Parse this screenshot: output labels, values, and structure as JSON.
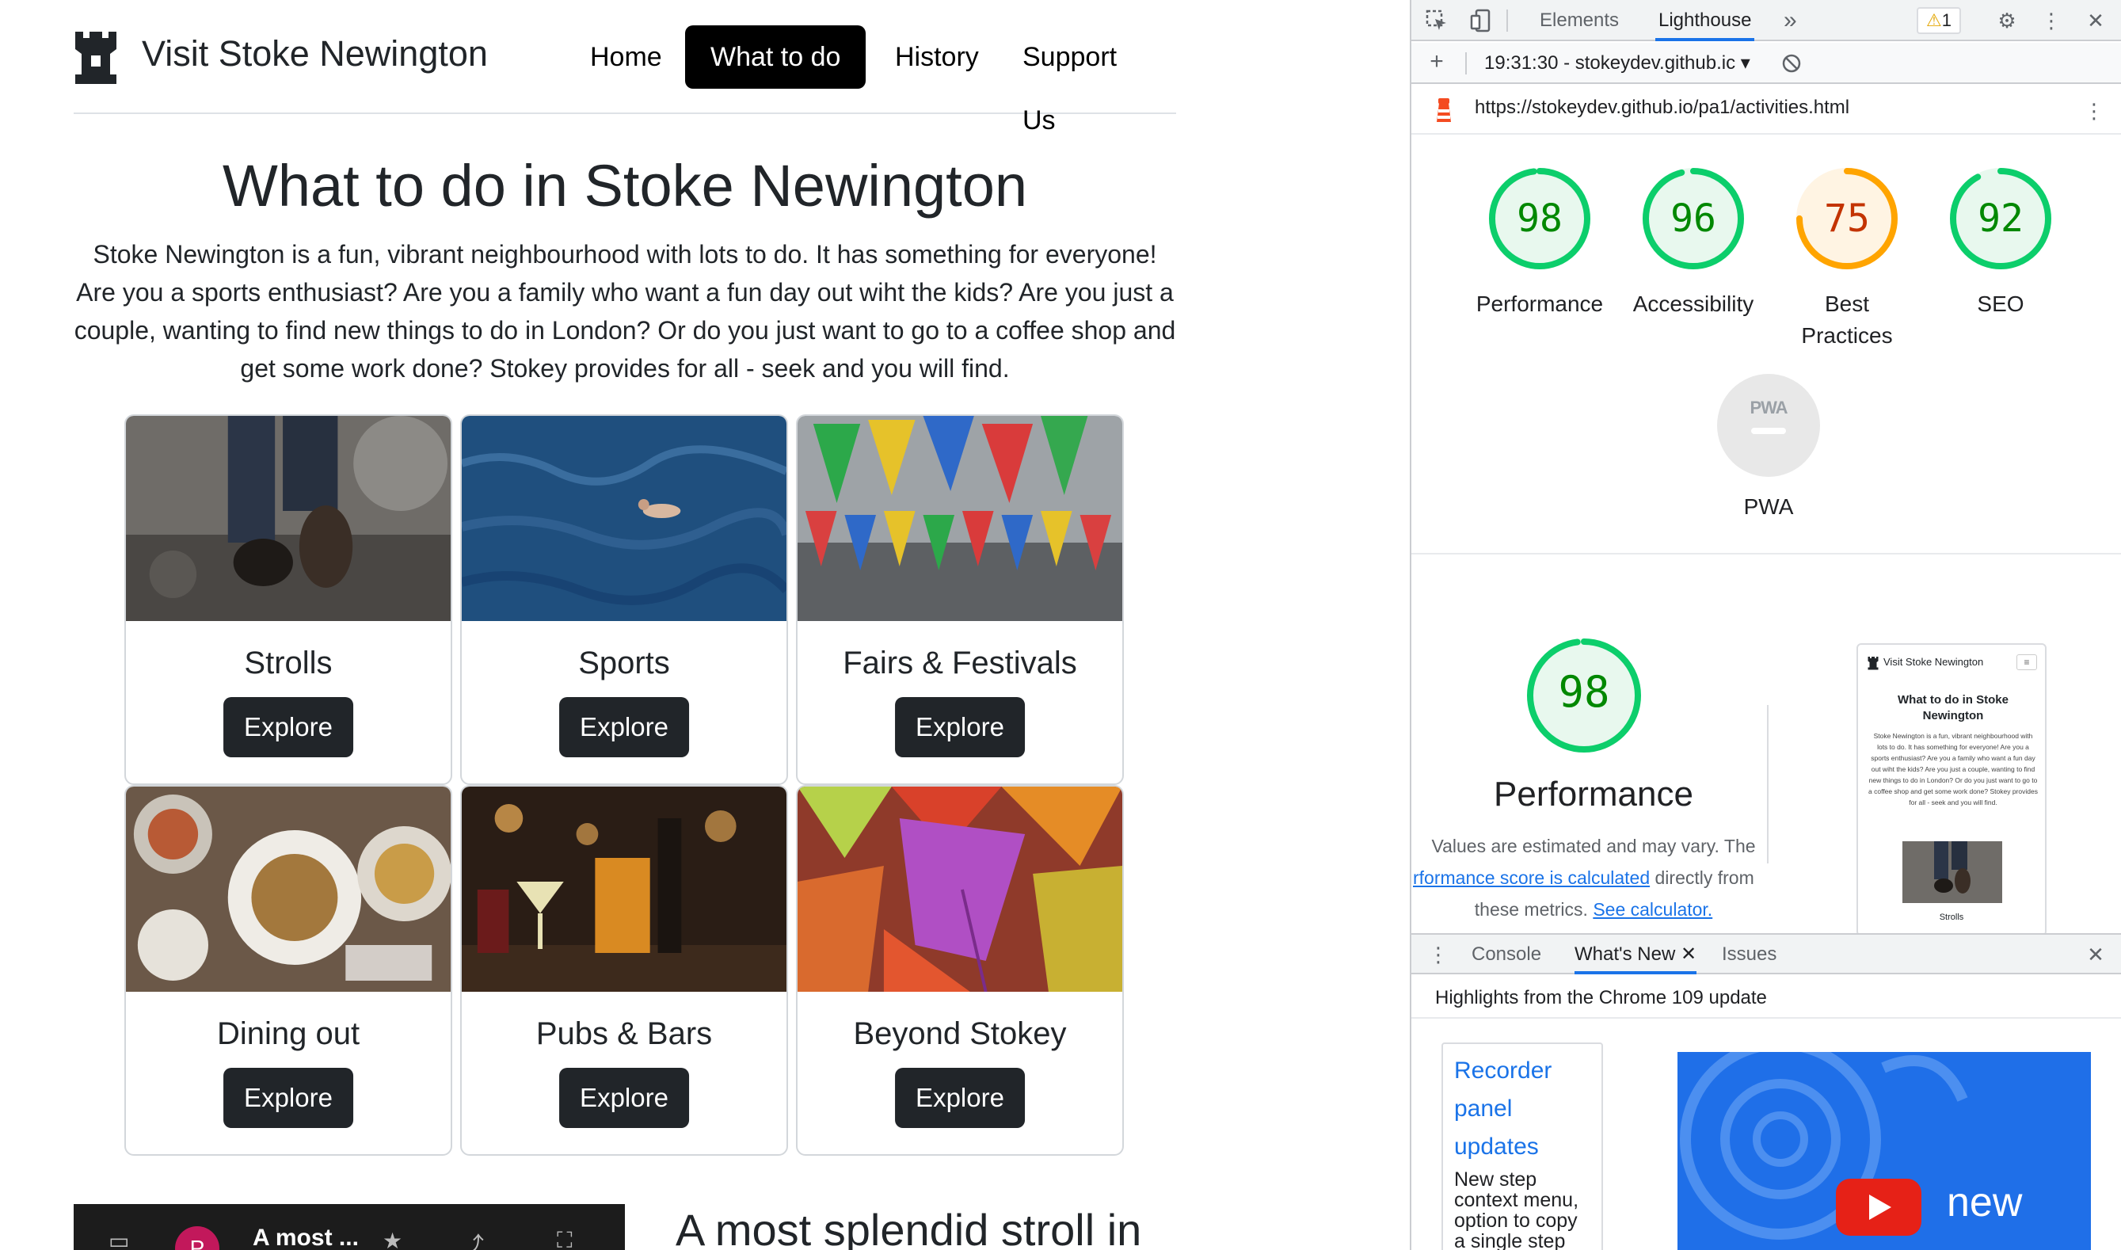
{
  "site": {
    "brand": "Visit Stoke Newington",
    "nav": [
      {
        "label": "Home",
        "active": false
      },
      {
        "label": "What to do",
        "active": true
      },
      {
        "label": "History",
        "active": false
      },
      {
        "label": "Support Us",
        "active": false
      }
    ],
    "title": "What to do in Stoke Newington",
    "intro": "Stoke Newington is a fun, vibrant neighbourhood with lots to do. It has something for everyone! Are you a sports enthusiast? Are you a family who want a fun day out wiht the kids? Are you just a couple, wanting to find new things to do in London? Or do you just want to go to a coffee shop and get some work done? Stokey provides for all - seek and you will find.",
    "cards": [
      {
        "title": "Strolls",
        "button": "Explore",
        "image": "feet-walking-photo"
      },
      {
        "title": "Sports",
        "button": "Explore",
        "image": "swimmer-sea-photo"
      },
      {
        "title": "Fairs & Festivals",
        "button": "Explore",
        "image": "bunting-photo"
      },
      {
        "title": "Dining out",
        "button": "Explore",
        "image": "dining-table-photo"
      },
      {
        "title": "Pubs & Bars",
        "button": "Explore",
        "image": "cocktails-photo"
      },
      {
        "title": "Beyond Stokey",
        "button": "Explore",
        "image": "autumn-leaves-photo"
      }
    ],
    "video": {
      "avatar_letter": "P",
      "title": "A most ..."
    },
    "section_heading": "A most splendid stroll in"
  },
  "devtools": {
    "tabs": [
      {
        "label": "Elements",
        "active": false
      },
      {
        "label": "Lighthouse",
        "active": true
      }
    ],
    "more_tabs": "»",
    "warning_count": "1",
    "report_select": "19:31:30 - stokeydev.github.ic ▾",
    "url": "https://stokeydev.github.io/pa1/activities.html",
    "scores": [
      {
        "value": "98",
        "label": "Performance",
        "color": "#0cce6b",
        "text_color": "#008800"
      },
      {
        "value": "96",
        "label": "Accessibility",
        "color": "#0cce6b",
        "text_color": "#008800"
      },
      {
        "value": "75",
        "label": "Best Practices",
        "color": "#ffa400",
        "text_color": "#c33300"
      },
      {
        "value": "92",
        "label": "SEO",
        "color": "#0cce6b",
        "text_color": "#008800"
      }
    ],
    "pwa": {
      "badge": "PWA",
      "label": "PWA"
    },
    "performance": {
      "value": "98",
      "heading": "Performance",
      "desc_line1": "Values are estimated and may vary. The",
      "desc_link": "rformance score is calculated",
      "desc_after_link": " directly from",
      "desc_line3_prefix": "these metrics. ",
      "desc_link2": "See calculator."
    },
    "thumbnail": {
      "brand": "Visit Stoke Newington",
      "title": "What to do in Stoke Newington",
      "body": "Stoke Newington is a fun, vibrant neighbourhood with lots to do. It has something for everyone! Are you a sports enthusiast? Are you a family who want a fun day out wiht the kids? Are you just a couple, wanting to find new things to do in London? Or do you just want to go to a coffee shop and get some work done? Stokey provides for all - seek and you will find.",
      "caption": "Strolls"
    },
    "drawer": {
      "tabs": [
        {
          "label": "Console",
          "active": false
        },
        {
          "label": "What's New",
          "active": true
        },
        {
          "label": "Issues",
          "active": false
        }
      ],
      "header": "Highlights from the Chrome 109 update",
      "card_heading_1": "Recorder",
      "card_heading_2": "panel",
      "card_heading_3": "updates",
      "card_text": "New step context menu, option to copy a single step from a",
      "video_text": "new"
    }
  }
}
